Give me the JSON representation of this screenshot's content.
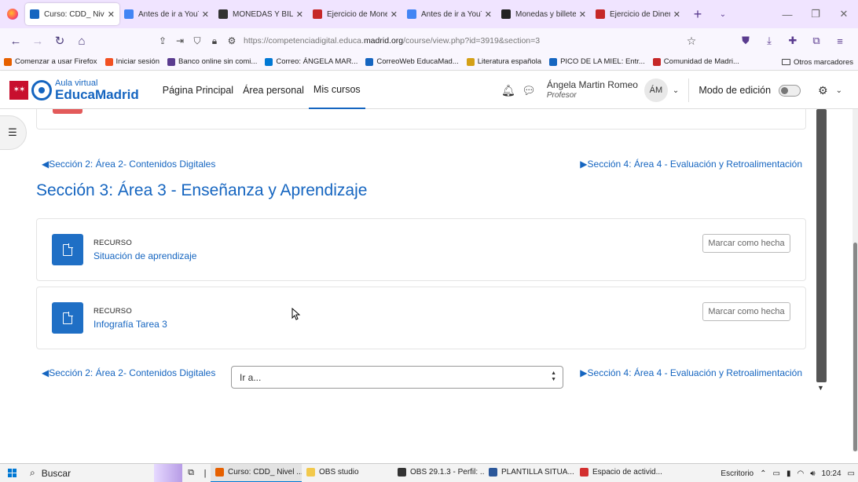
{
  "browser": {
    "tabs": [
      {
        "title": "Curso: CDD_ Nivel",
        "color": "#1565c0",
        "active": true
      },
      {
        "title": "Antes de ir a YouTube",
        "color": "#4285f4",
        "active": false
      },
      {
        "title": "MONEDAS Y BILLETES",
        "color": "#333333",
        "active": false
      },
      {
        "title": "Ejercicio de Monedas",
        "color": "#c62828",
        "active": false
      },
      {
        "title": "Antes de ir a YouTube",
        "color": "#4285f4",
        "active": false
      },
      {
        "title": "Monedas y billetes",
        "color": "#222222",
        "active": false
      },
      {
        "title": "Ejercicio de Dinero",
        "color": "#c62828",
        "active": false
      }
    ],
    "tab_close": "✕",
    "new_tab": "+",
    "url_prefix": "https://competenciadigital.educa.",
    "url_domain": "madrid.org",
    "url_suffix": "/course/view.php?id=3919&section=3",
    "bookmarks": [
      {
        "label": "Comenzar a usar Firefox",
        "color": "#e66000"
      },
      {
        "label": "Iniciar sesión",
        "color": "#f25022"
      },
      {
        "label": "Banco online sin comi...",
        "color": "#5a3b8f"
      },
      {
        "label": "Correo: ÁNGELA MAR...",
        "color": "#0078d4"
      },
      {
        "label": "CorreoWeb EducaMad...",
        "color": "#1565c0"
      },
      {
        "label": "Literatura española",
        "color": "#d4a017"
      },
      {
        "label": "PICO DE LA MIEL: Entr...",
        "color": "#1565c0"
      },
      {
        "label": "Comunidad de Madri...",
        "color": "#c62828"
      }
    ],
    "other_bookmarks": "Otros marcadores"
  },
  "header": {
    "logo_small": "Aula virtual",
    "logo_big": "EducaMadrid",
    "nav": [
      {
        "label": "Página Principal",
        "active": false
      },
      {
        "label": "Área personal",
        "active": false
      },
      {
        "label": "Mis cursos",
        "active": true
      }
    ],
    "user_name": "Ángela Martin Romeo",
    "user_role": "Profesor",
    "avatar_initials": "ÁM",
    "edit_mode_label": "Modo de edición"
  },
  "section": {
    "prev_link": "◀Sección 2: Área 2- Contenidos Digitales",
    "next_link": "▶Sección 4: Área 4 - Evaluación y Retroalimentación",
    "title": "Sección 3: Área 3 - Enseñanza y Aprendizaje",
    "activities": [
      {
        "type": "RECURSO",
        "name": "Situación de aprendizaje",
        "button": "Marcar como hecha"
      },
      {
        "type": "RECURSO",
        "name": "Infografía Tarea 3",
        "button": "Marcar como hecha"
      }
    ],
    "goto_placeholder": "Ir a..."
  },
  "taskbar": {
    "search_label": "Buscar",
    "items": [
      {
        "label": "Curso: CDD_ Nivel ...",
        "color": "#e66000",
        "active": true
      },
      {
        "label": "OBS studio",
        "color": "#f2c94c",
        "active": false
      },
      {
        "label": "OBS 29.1.3 - Perfil: ...",
        "color": "#333333",
        "active": false
      },
      {
        "label": "PLANTILLA SITUA...",
        "color": "#2b579a",
        "active": false
      },
      {
        "label": "Espacio de activid...",
        "color": "#d32f2f",
        "active": false
      }
    ],
    "desktop_label": "Escritorio",
    "time": "10:24"
  }
}
